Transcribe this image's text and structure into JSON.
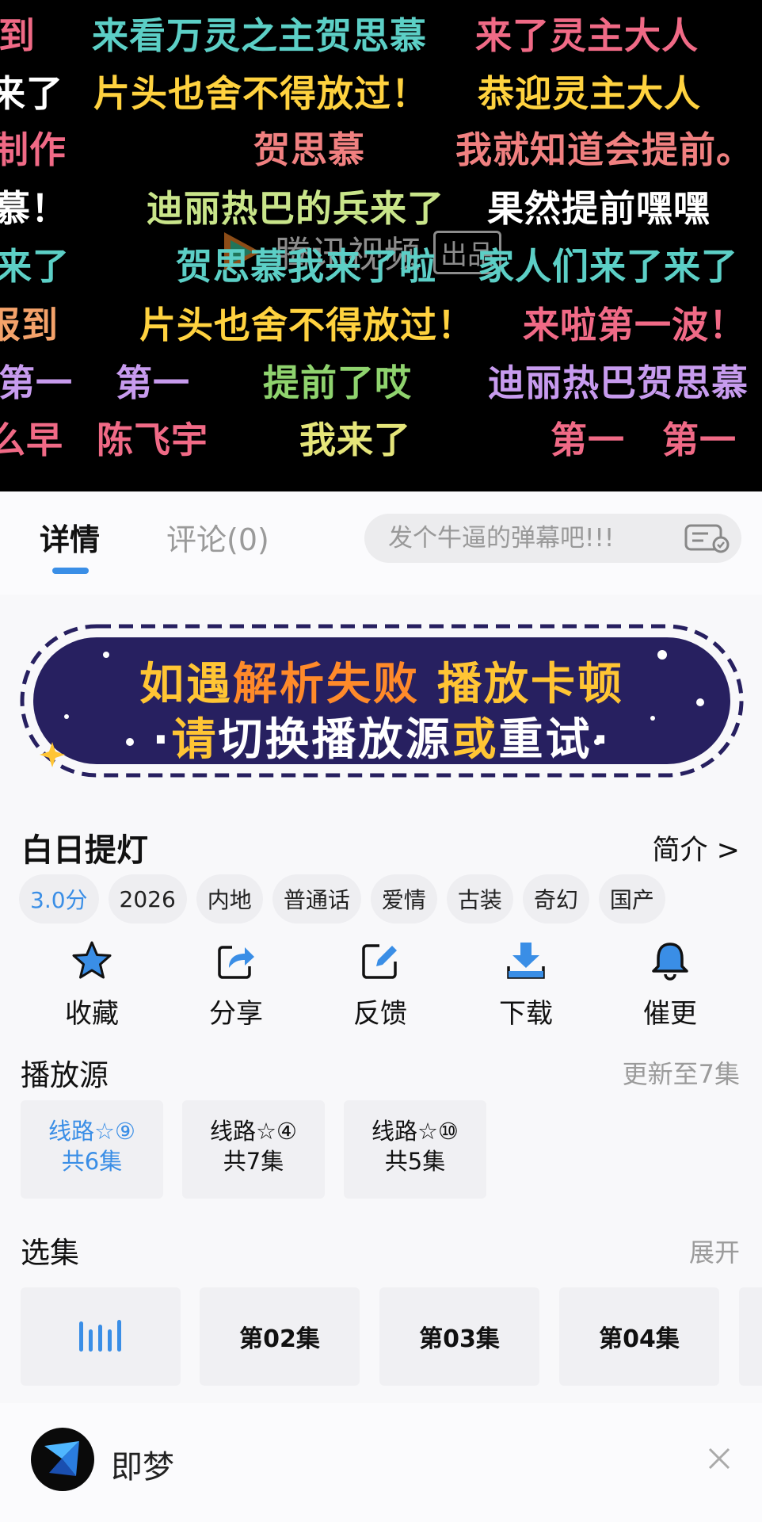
{
  "player": {
    "danmaku": [
      {
        "text": "到",
        "color": "#f06a86"
      },
      {
        "text": "来看万灵之主贺思慕",
        "color": "#5ccfc6"
      },
      {
        "text": "来了灵主大人",
        "color": "#f06a86"
      },
      {
        "text": "来了",
        "color": "#ffffff"
      },
      {
        "text": "片头也舍不得放过！",
        "color": "#ffd23f"
      },
      {
        "text": "恭迎灵主大人",
        "color": "#ffd23f"
      },
      {
        "text": "制作",
        "color": "#f06a86"
      },
      {
        "text": "贺思慕",
        "color": "#f08080"
      },
      {
        "text": "我就知道会提前。",
        "color": "#f08080"
      },
      {
        "text": "慕！",
        "color": "#ffffff"
      },
      {
        "text": "迪丽热巴的兵来了",
        "color": "#c9e58a"
      },
      {
        "text": "果然提前嘿嘿",
        "color": "#ffffff"
      },
      {
        "text": "来了",
        "color": "#5ccfc6"
      },
      {
        "text": "贺思慕我来了啦",
        "color": "#5ccfc6"
      },
      {
        "text": "家人们来了来了",
        "color": "#5ccfc6"
      },
      {
        "text": "报到",
        "color": "#f4a26a"
      },
      {
        "text": "片头也舍不得放过！",
        "color": "#ffd23f"
      },
      {
        "text": "来啦第一波！",
        "color": "#f06a86"
      },
      {
        "text": "第一",
        "color": "#c79bee"
      },
      {
        "text": "第一",
        "color": "#c79bee"
      },
      {
        "text": "提前了哎",
        "color": "#8fd36e"
      },
      {
        "text": "迪丽热巴贺思慕",
        "color": "#c79bee"
      },
      {
        "text": "么早",
        "color": "#f06a86"
      },
      {
        "text": "陈飞宇",
        "color": "#f06a86"
      },
      {
        "text": "我来了",
        "color": "#e5e57a"
      },
      {
        "text": "第一",
        "color": "#f06a86"
      },
      {
        "text": "第一",
        "color": "#f06a86"
      }
    ],
    "watermark": {
      "text": "腾讯视频",
      "badge": "出品"
    }
  },
  "tabs": {
    "detail": "详情",
    "comment": "评论(0)"
  },
  "danmaku_input": {
    "placeholder": "发个牛逼的弹幕吧!!!"
  },
  "banner": {
    "line1": [
      "如遇",
      "解析失败",
      "播放卡顿"
    ],
    "line2": [
      "请",
      "切换播放源",
      "或",
      "重试"
    ]
  },
  "show": {
    "title": "白日提灯",
    "intro_link": "简介 >",
    "tags": [
      "3.0分",
      "2026",
      "内地",
      "普通话",
      "爱情",
      "古装",
      "奇幻",
      "国产"
    ]
  },
  "actions": [
    {
      "label": "收藏",
      "icon": "star-icon"
    },
    {
      "label": "分享",
      "icon": "share-icon"
    },
    {
      "label": "反馈",
      "icon": "edit-icon"
    },
    {
      "label": "下载",
      "icon": "download-icon"
    },
    {
      "label": "催更",
      "icon": "bell-icon"
    }
  ],
  "sources": {
    "title": "播放源",
    "update": "更新至7集",
    "items": [
      {
        "name": "线路☆⑨",
        "count": "共6集"
      },
      {
        "name": "线路☆④",
        "count": "共7集"
      },
      {
        "name": "线路☆⑩",
        "count": "共5集"
      }
    ]
  },
  "episodes": {
    "title": "选集",
    "expand": "展开",
    "items": [
      "第02集",
      "第03集",
      "第04集"
    ]
  },
  "ad": {
    "name": "即梦"
  },
  "colors": {
    "accent": "#3a8ee6",
    "banner_bg": "#272060",
    "banner_yellow": "#ffc534"
  }
}
